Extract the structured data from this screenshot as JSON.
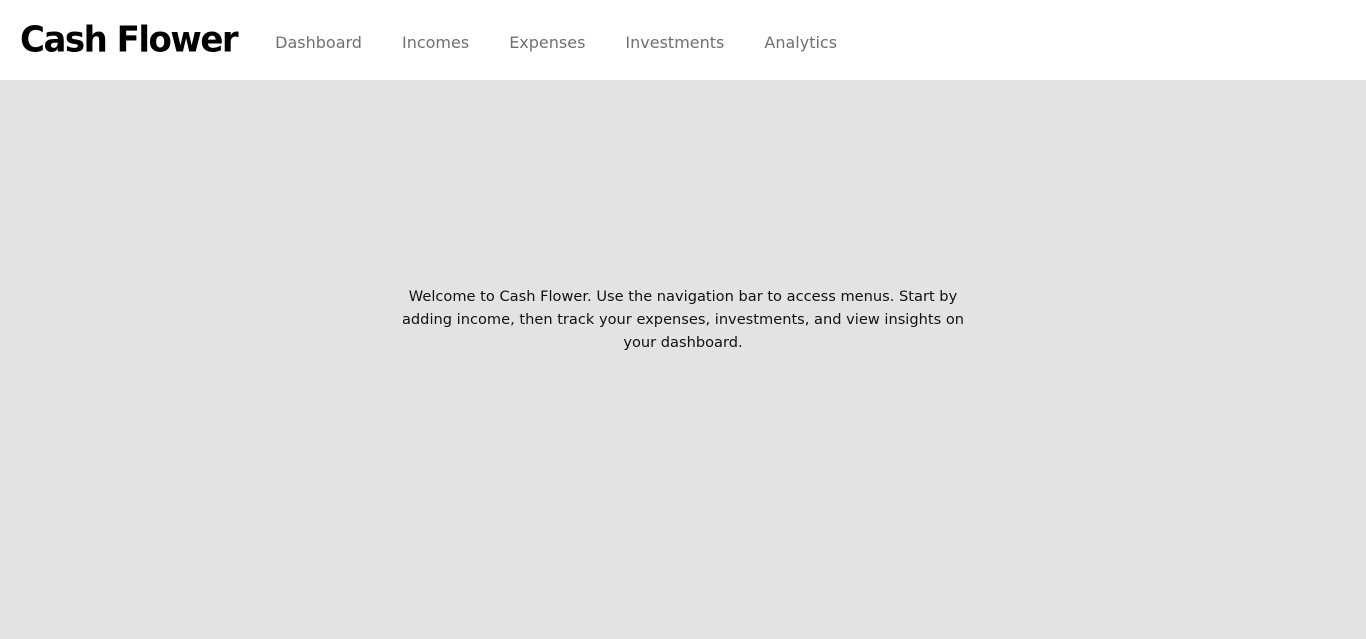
{
  "brand": {
    "name": "Cash Flower"
  },
  "nav": {
    "items": [
      {
        "label": "Dashboard"
      },
      {
        "label": "Incomes"
      },
      {
        "label": "Expenses"
      },
      {
        "label": "Investments"
      },
      {
        "label": "Analytics"
      }
    ]
  },
  "main": {
    "welcome_text": "Welcome to Cash Flower. Use the navigation bar to access menus. Start by adding income, then track your expenses, investments, and view insights on your dashboard."
  },
  "colors": {
    "navbar_bg": "#ffffff",
    "content_bg": "#e3e3e3",
    "nav_link": "#707070",
    "brand": "#000000",
    "text": "#111111"
  }
}
